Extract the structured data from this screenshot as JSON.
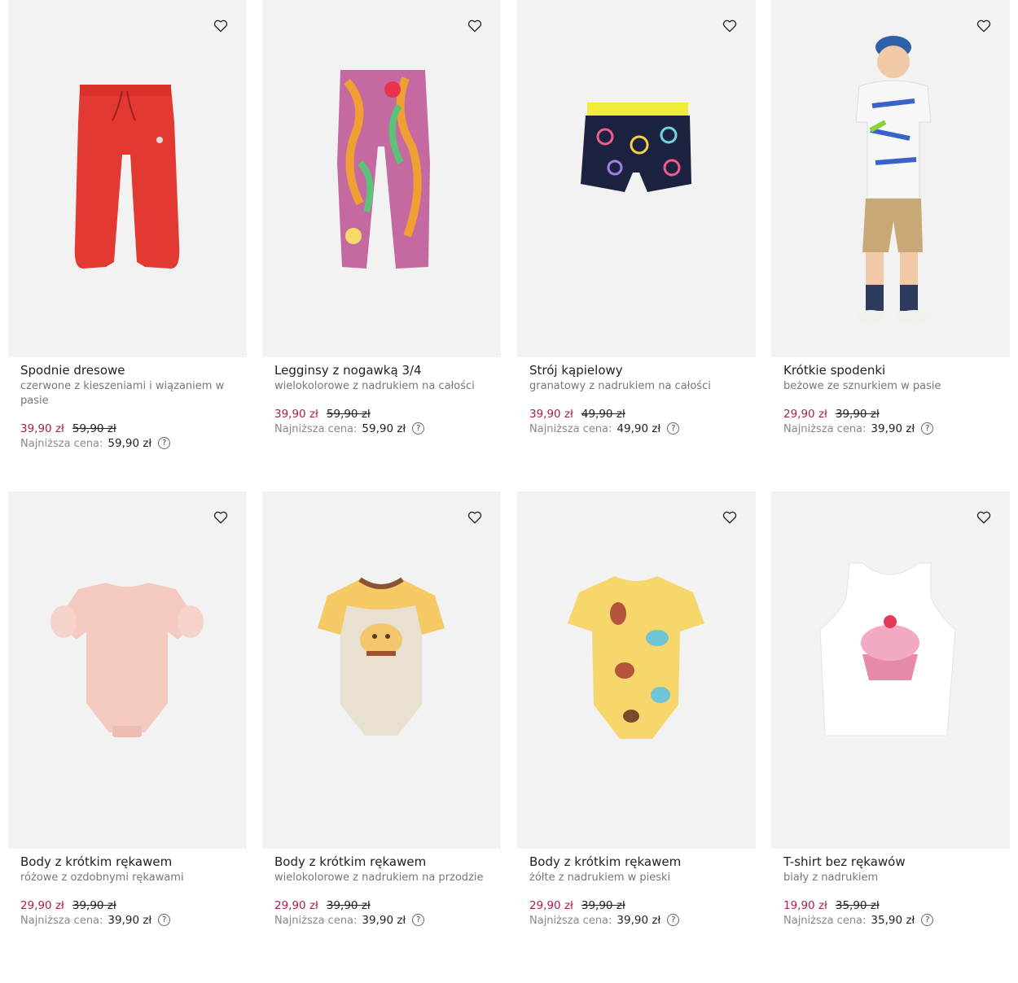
{
  "products": [
    {
      "name": "Spodnie dresowe",
      "description": "czerwone z kieszeniami i wiązaniem w pasie",
      "price": "39,90 zł",
      "old_price": "59,90 zł",
      "lowest_label": "Najniższa cena:",
      "lowest_price": "59,90 zł",
      "color": "#e23a33"
    },
    {
      "name": "Legginsy z nogawką 3/4",
      "description": "wielokolorowe z nadrukiem na całości",
      "price": "39,90 zł",
      "old_price": "59,90 zł",
      "lowest_label": "Najniższa cena:",
      "lowest_price": "59,90 zł",
      "color": "#c46aa0"
    },
    {
      "name": "Strój kąpielowy",
      "description": "granatowy z nadrukiem na całości",
      "price": "39,90 zł",
      "old_price": "49,90 zł",
      "lowest_label": "Najniższa cena:",
      "lowest_price": "49,90 zł",
      "color": "#1c2340"
    },
    {
      "name": "Krótkie spodenki",
      "description": "beżowe ze sznurkiem w pasie",
      "price": "29,90 zł",
      "old_price": "39,90 zł",
      "lowest_label": "Najniższa cena:",
      "lowest_price": "39,90 zł",
      "color": "#c9a878"
    },
    {
      "name": "Body z krótkim rękawem",
      "description": "różowe z ozdobnymi rękawami",
      "price": "29,90 zł",
      "old_price": "39,90 zł",
      "lowest_label": "Najniższa cena:",
      "lowest_price": "39,90 zł",
      "color": "#f4c9bf"
    },
    {
      "name": "Body z krótkim rękawem",
      "description": "wielokolorowe z nadrukiem na przodzie",
      "price": "29,90 zł",
      "old_price": "39,90 zł",
      "lowest_label": "Najniższa cena:",
      "lowest_price": "39,90 zł",
      "color": "#e8e1d2"
    },
    {
      "name": "Body z krótkim rękawem",
      "description": "żółte z nadrukiem w pieski",
      "price": "29,90 zł",
      "old_price": "39,90 zł",
      "lowest_label": "Najniższa cena:",
      "lowest_price": "39,90 zł",
      "color": "#f7d66b"
    },
    {
      "name": "T-shirt bez rękawów",
      "description": "biały z nadrukiem",
      "price": "19,90 zł",
      "old_price": "35,90 zł",
      "lowest_label": "Najniższa cena:",
      "lowest_price": "35,90 zł",
      "color": "#ffffff"
    }
  ],
  "icons": {
    "wishlist": "heart-outline-icon",
    "help": "question-circle-icon"
  },
  "help_glyph": "?",
  "colors": {
    "sale_price": "#a5204b",
    "card_bg": "#f2f2f2"
  }
}
